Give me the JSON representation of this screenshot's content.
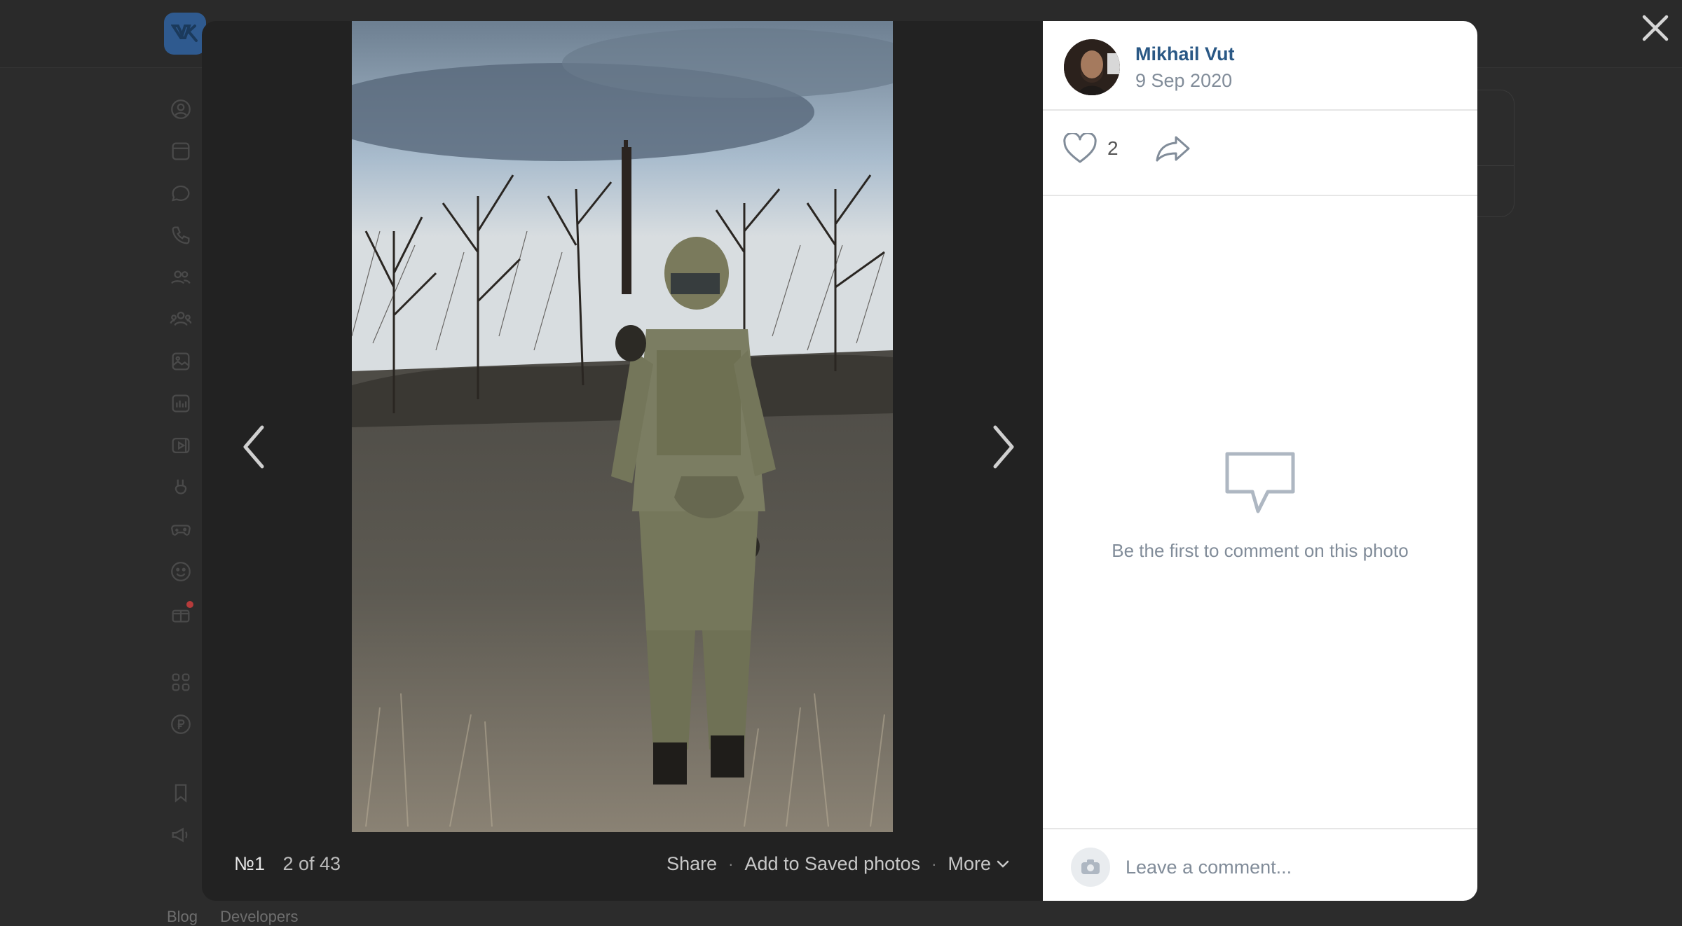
{
  "viewer": {
    "counter_num": "№1",
    "counter_text": "2 of 43",
    "actions": {
      "share": "Share",
      "save": "Add to Saved photos",
      "more": "More"
    }
  },
  "author": {
    "name": "Mikhail Vut",
    "date": "9 Sep 2020"
  },
  "likes": {
    "count": "2"
  },
  "comments": {
    "empty_text": "Be the first to comment on this photo",
    "placeholder": "Leave a comment..."
  },
  "background": {
    "footer_links": [
      "Blog",
      "Developers"
    ],
    "sidebar_icons": [
      "profile-icon",
      "news-icon",
      "messages-icon",
      "calls-icon",
      "friends-icon",
      "communities-icon",
      "photos-icon",
      "music-icon",
      "videos-icon",
      "clips-icon",
      "games-icon",
      "stickers-icon",
      "gifts-icon",
      "apps-icon",
      "payments-icon",
      "bookmarks-icon",
      "ads-icon"
    ]
  },
  "colors": {
    "link": "#2a5885",
    "secondary": "#818c99",
    "brand": "#2f5a8f"
  }
}
